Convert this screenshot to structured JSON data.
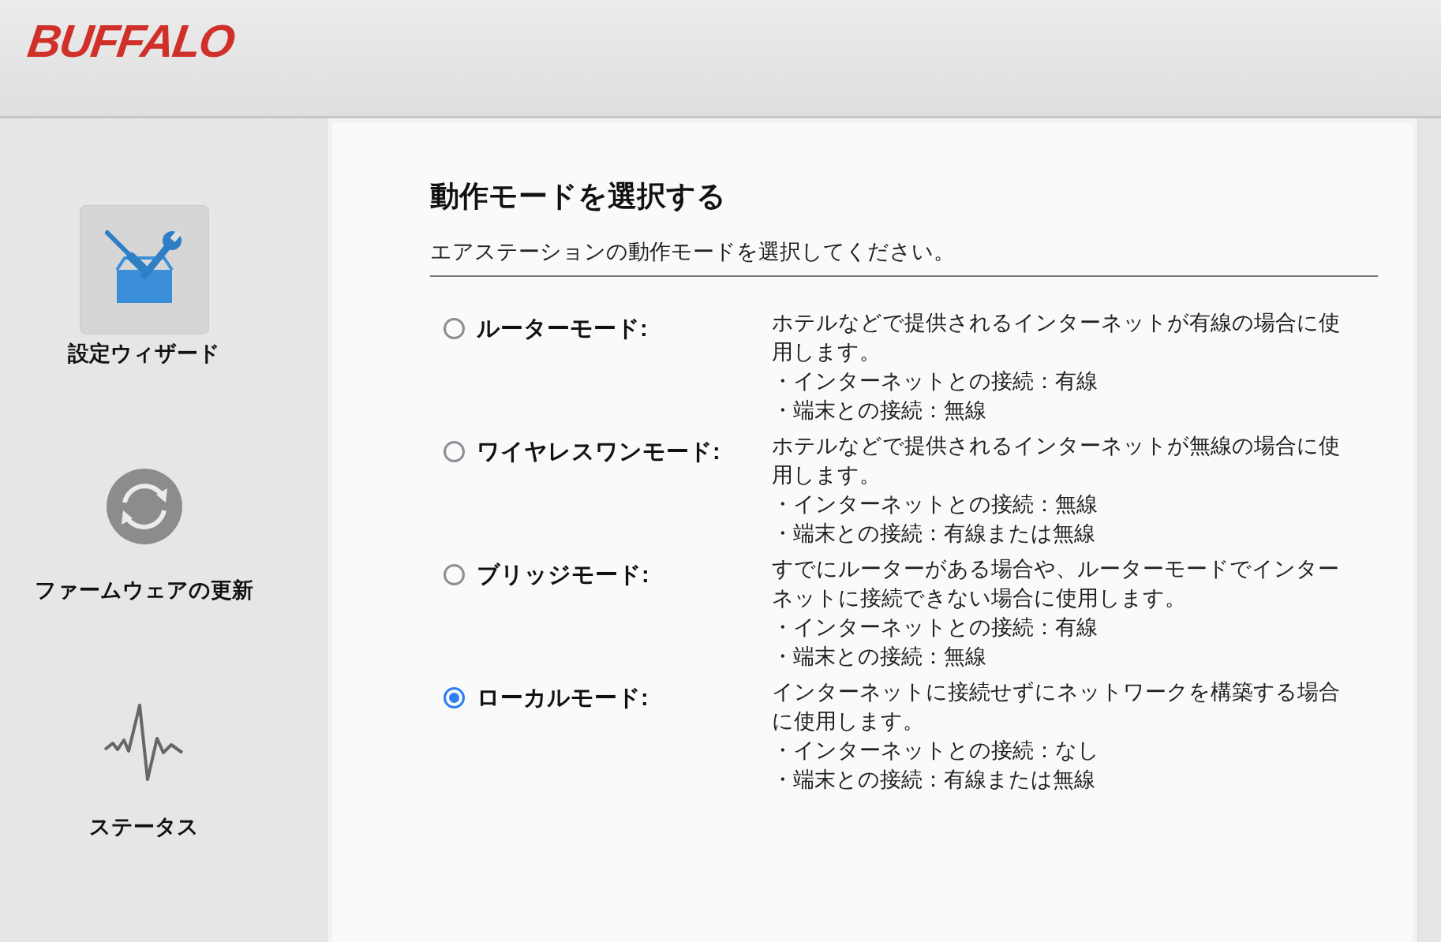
{
  "header": {
    "logo": "BUFFALO"
  },
  "sidebar": {
    "items": [
      {
        "kind": "wizard",
        "label": "設定ウィザード",
        "selected": true
      },
      {
        "kind": "firmware",
        "label": "ファームウェアの更新",
        "selected": false
      },
      {
        "kind": "status",
        "label": "ステータス",
        "selected": false
      }
    ]
  },
  "panel": {
    "title": "動作モードを選択する",
    "subtitle": "エアステーションの動作モードを選択してください。",
    "modes": [
      {
        "label": "ルーターモード:",
        "selected": false,
        "description": "ホテルなどで提供されるインターネットが有線の場合に使用します。",
        "bullets": [
          "・インターネットとの接続：有線",
          "・端末との接続：無線"
        ]
      },
      {
        "label": "ワイヤレスワンモード:",
        "selected": false,
        "description": "ホテルなどで提供されるインターネットが無線の場合に使用します。",
        "bullets": [
          "・インターネットとの接続：無線",
          "・端末との接続：有線または無線"
        ]
      },
      {
        "label": "ブリッジモード:",
        "selected": false,
        "description": "すでにルーターがある場合や、ルーターモードでインターネットに接続できない場合に使用します。",
        "bullets": [
          "・インターネットとの接続：有線",
          "・端末との接続：無線"
        ]
      },
      {
        "label": "ローカルモード:",
        "selected": true,
        "description": "インターネットに接続せずにネットワークを構築する場合に使用します。",
        "bullets": [
          "・インターネットとの接続：なし",
          "・端末との接続：有線または無線"
        ]
      }
    ]
  }
}
